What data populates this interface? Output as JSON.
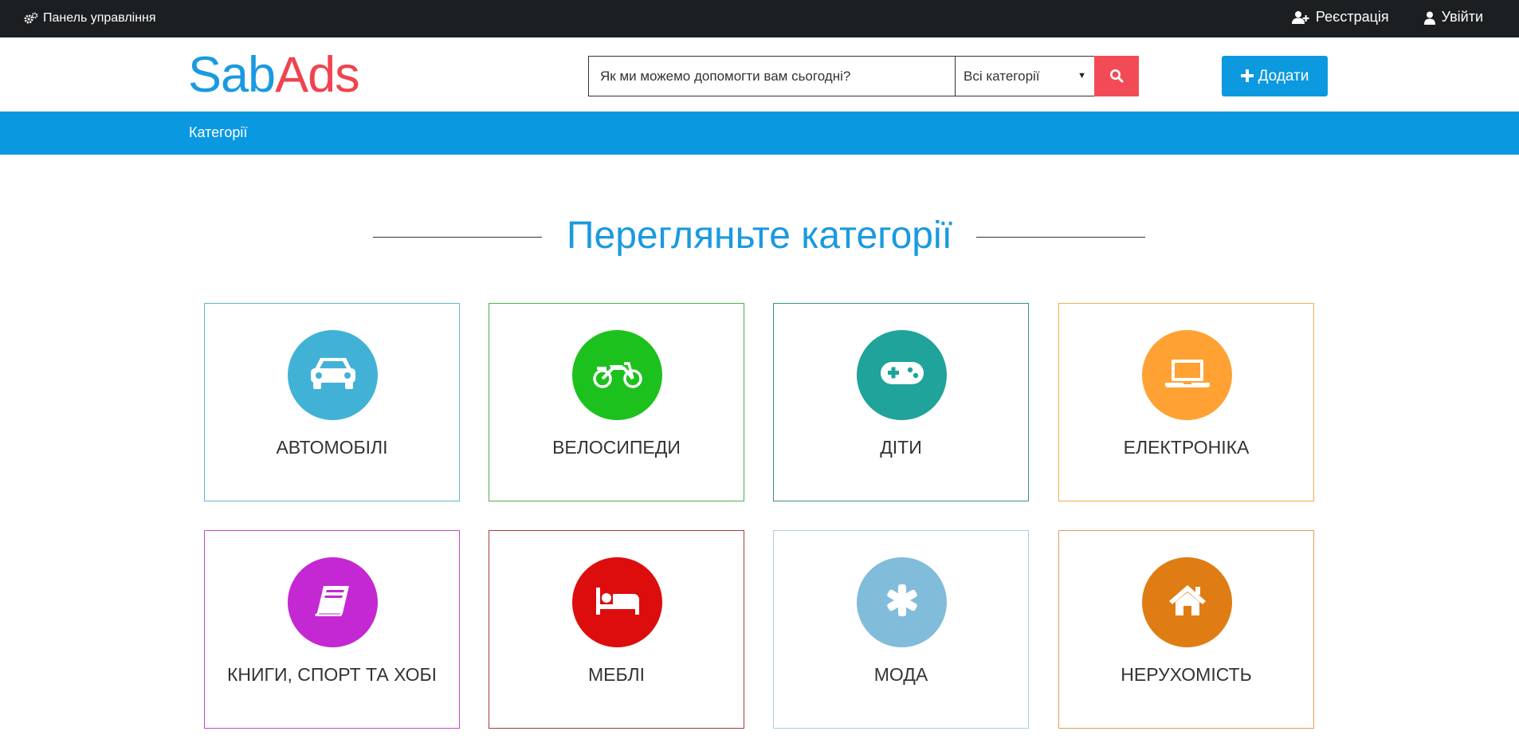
{
  "topbar": {
    "admin_label": "Панель управління",
    "register_label": "Реєстрація",
    "login_label": "Увійти"
  },
  "header": {
    "logo_part1": "Sab",
    "logo_part2": "Ads",
    "search_placeholder": "Як ми можемо допомогти вам сьогодні?",
    "category_select": "Всі категорії",
    "add_button": "Додати"
  },
  "navbar": {
    "categories_label": "Категорії"
  },
  "section": {
    "title": "Перегляньте категорії"
  },
  "categories": [
    {
      "label": "АВТОМОБІЛІ",
      "icon": "car-icon",
      "color": "#41b2d6",
      "border": "#62b6c9"
    },
    {
      "label": "ВЕЛОСИПЕДИ",
      "icon": "motorcycle-icon",
      "color": "#1dc11d",
      "border": "#4cb04c"
    },
    {
      "label": "ДІТИ",
      "icon": "gamepad-icon",
      "color": "#1fa39b",
      "border": "#3a8f8b"
    },
    {
      "label": "ЕЛЕКТРОНІКА",
      "icon": "laptop-icon",
      "color": "#ffa133",
      "border": "#efb04c"
    },
    {
      "label": "КНИГИ, СПОРТ ТА ХОБІ",
      "icon": "book-icon",
      "color": "#c428d2",
      "border": "#c847cf"
    },
    {
      "label": "МЕБЛІ",
      "icon": "bed-icon",
      "color": "#dd0d0d",
      "border": "#a83a3a"
    },
    {
      "label": "МОДА",
      "icon": "asterisk-icon",
      "color": "#82bcdb",
      "border": "#a6cde2"
    },
    {
      "label": "НЕРУХОМІСТЬ",
      "icon": "home-icon",
      "color": "#df7d14",
      "border": "#e29a5a"
    }
  ],
  "colors": {
    "topbar_bg": "#1b1f22",
    "brand_blue": "#1a9ae0",
    "brand_red": "#f0434f",
    "nav_blue": "#0a99e1",
    "search_button": "#f24b55"
  }
}
